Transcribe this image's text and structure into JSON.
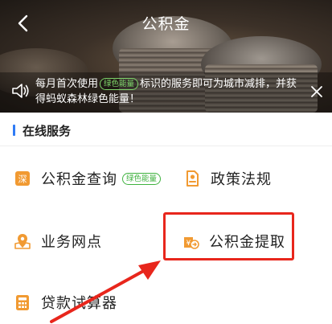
{
  "header": {
    "title": "公积金",
    "back_icon": "chevron-left-icon"
  },
  "notice": {
    "text_before": "每月首次使用",
    "badge": "绿色能量",
    "text_after": "标识的服务即可为城市减排，并获得蚂蚁森林绿色能量！",
    "icon": "speaker-icon",
    "close_icon": "close-icon"
  },
  "section": {
    "title": "在线服务"
  },
  "services": [
    {
      "label": "公积金查询",
      "badge": "绿色能量",
      "icon": "deposit-query-icon",
      "icon_color": "#f19a32"
    },
    {
      "label": "政策法规",
      "icon": "policy-document-icon",
      "icon_color": "#f19a32"
    },
    {
      "label": "业务网点",
      "icon": "map-location-icon",
      "icon_color": "#f19a32"
    },
    {
      "label": "公积金提取",
      "icon": "withdraw-icon",
      "icon_color": "#f19a32"
    },
    {
      "label": "贷款试算器",
      "icon": "calculator-icon",
      "icon_color": "#f19a32"
    }
  ],
  "colors": {
    "accent": "#2f7bf5",
    "annotation": "#e8261c",
    "green_badge": "#3fb23f"
  }
}
